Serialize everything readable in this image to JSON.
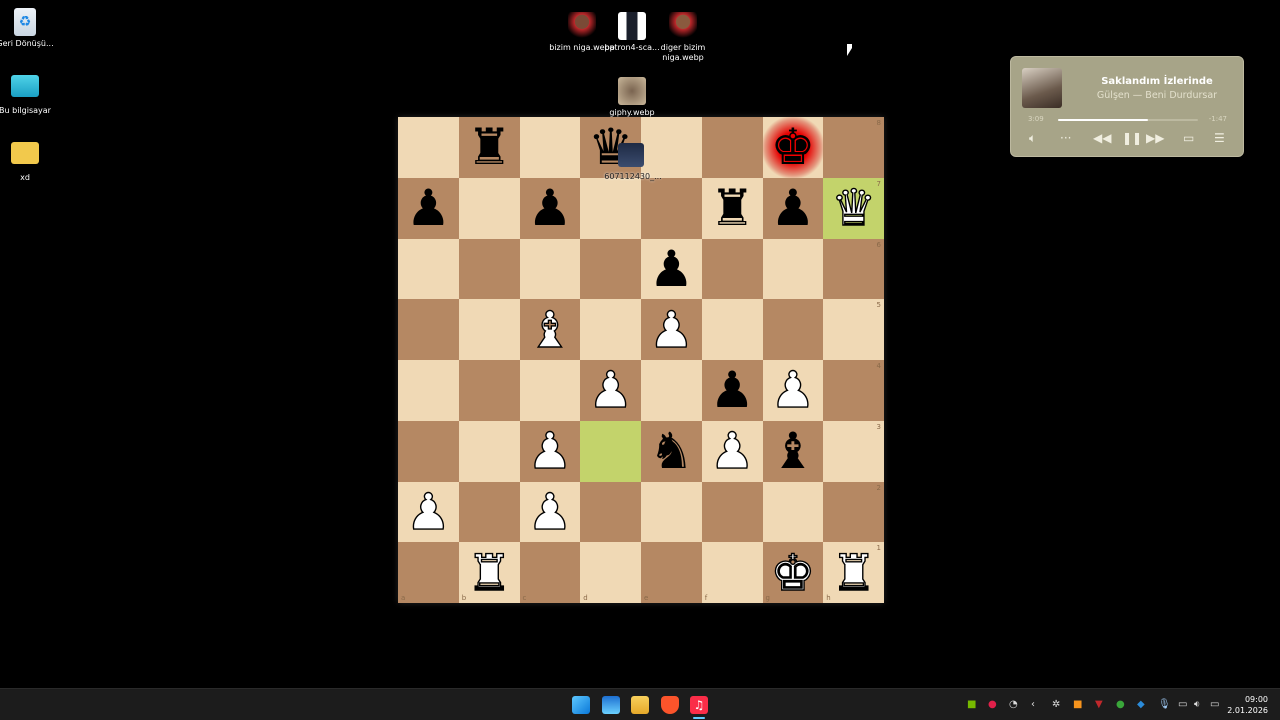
{
  "desktop_icons": [
    {
      "label": "Geri Dönüşü...",
      "icon": "recycle-bin-icon"
    },
    {
      "label": "Bu bilgisayar",
      "icon": "computer-icon"
    },
    {
      "label": "xd",
      "icon": "folder-icon"
    },
    {
      "label": "bizim niga.webp",
      "icon": "image-file-icon"
    },
    {
      "label": "patron4-sca...",
      "icon": "image-file-icon"
    },
    {
      "label": "diger bizim niga.webp",
      "icon": "image-file-icon"
    },
    {
      "label": "giphy.webp",
      "icon": "image-file-icon"
    },
    {
      "label": "607112430_...",
      "icon": "image-file-icon"
    }
  ],
  "chess": {
    "rows": [
      ".r.q..k.",
      "p.p..rpQ",
      "....p...",
      "..B.P...",
      "...P.pP.",
      "..P.nPb.",
      "P.P.....",
      ".R....KR"
    ],
    "files": [
      "a",
      "b",
      "c",
      "d",
      "e",
      "f",
      "g",
      "h"
    ],
    "ranks": [
      "8",
      "7",
      "6",
      "5",
      "4",
      "3",
      "2",
      "1"
    ],
    "last_move_squares": [
      "h7",
      "d3"
    ],
    "check_square": "g8",
    "colors": {
      "light": "#f0d9b5",
      "dark": "#b58863",
      "highlight": "#c3d36b",
      "check": "#e50000"
    }
  },
  "player": {
    "title": "Saklandım İzlerinde",
    "artist_album": "Gülşen — Beni Durdursar",
    "elapsed": "3:09",
    "remaining": "-1:47",
    "progress_percent": 64,
    "controls": [
      "volume-icon",
      "more-icon",
      "rewind-icon",
      "pause-icon",
      "fast-forward-icon",
      "lyrics-icon",
      "queue-icon"
    ]
  },
  "taskbar": {
    "apps": [
      "start-icon",
      "widgets-icon",
      "file-explorer-icon",
      "brave-icon",
      "apple-music-icon"
    ],
    "tray": [
      "nvidia-icon",
      "tray-app-red-icon",
      "tray-app-icon",
      "chevron-icon",
      "steelseries-icon",
      "avast-icon",
      "tray-red-icon",
      "xbox-icon",
      "defender-icon",
      "microphone-icon",
      "network-icon",
      "volume-icon",
      "battery-icon"
    ],
    "time": "09:00",
    "date": "2.01.2026"
  }
}
